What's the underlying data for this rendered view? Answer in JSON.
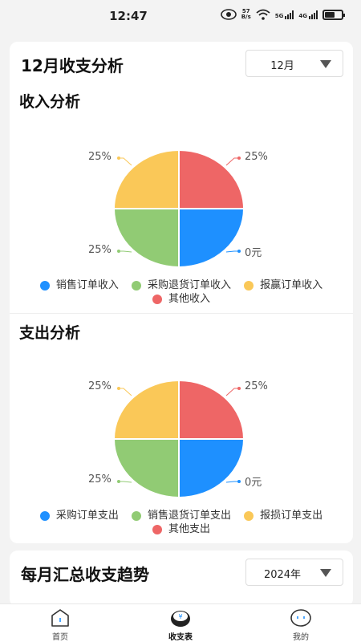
{
  "status_bar": {
    "time": "12:47",
    "net_speed_value": "57",
    "net_speed_unit": "B/s",
    "signal1": "5G",
    "signal2": "4G",
    "battery_level": 0.6,
    "icons": [
      "eye-icon",
      "wifi-icon",
      "signal-icon",
      "battery-icon"
    ]
  },
  "card1": {
    "title": "12月收支分析",
    "month_select": "12月",
    "income": {
      "title": "收入分析",
      "labels": {
        "top_left": "25%",
        "top_right": "25%",
        "bottom_left": "25%",
        "bottom_right": "0元"
      },
      "legend": [
        {
          "label": "销售订单收入",
          "color": "#1e90ff"
        },
        {
          "label": "采购退货订单收入",
          "color": "#91cb74"
        },
        {
          "label": "报赢订单收入",
          "color": "#fac858"
        },
        {
          "label": "其他收入",
          "color": "#ee6666"
        }
      ]
    },
    "expense": {
      "title": "支出分析",
      "labels": {
        "top_left": "25%",
        "top_right": "25%",
        "bottom_left": "25%",
        "bottom_right": "0元"
      },
      "legend": [
        {
          "label": "采购订单支出",
          "color": "#1e90ff"
        },
        {
          "label": "销售退货订单支出",
          "color": "#91cb74"
        },
        {
          "label": "报损订单支出",
          "color": "#fac858"
        },
        {
          "label": "其他支出",
          "color": "#ee6666"
        }
      ]
    }
  },
  "card2": {
    "title": "每月汇总收支趋势",
    "year_select": "2024年"
  },
  "tabbar": {
    "tabs": [
      {
        "label": "首页",
        "icon": "home-icon"
      },
      {
        "label": "收支表",
        "icon": "finance-icon"
      },
      {
        "label": "我的",
        "icon": "profile-icon"
      }
    ]
  }
}
